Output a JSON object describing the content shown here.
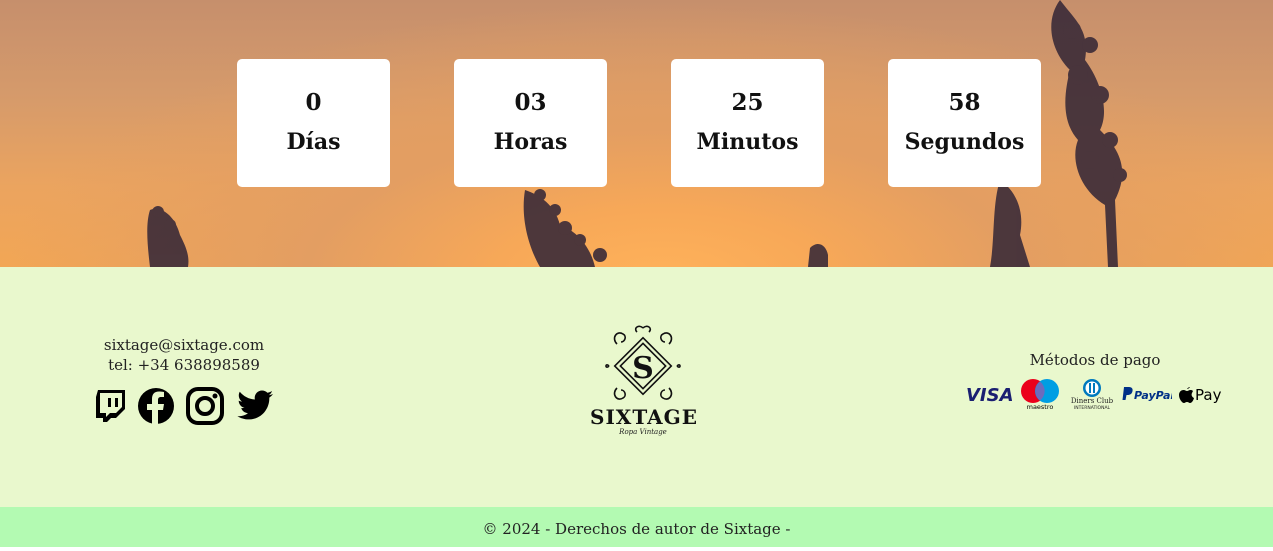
{
  "countdown": [
    {
      "value": "0",
      "label": "Días"
    },
    {
      "value": "03",
      "label": "Horas"
    },
    {
      "value": "25",
      "label": "Minutos"
    },
    {
      "value": "58",
      "label": "Segundos"
    }
  ],
  "contact": {
    "email": "sixtage@sixtage.com",
    "phone": "tel: +34 638898589"
  },
  "socials": [
    "twitch-icon",
    "facebook-icon",
    "instagram-icon",
    "twitter-icon"
  ],
  "brand": {
    "name": "SIXTAGE",
    "tagline": "Ropa Vintage"
  },
  "payments": {
    "title": "Métodos de pago",
    "methods": [
      "VISA",
      "maestro",
      "Diners Club INTERNATIONAL",
      "PayPal",
      "Pay"
    ]
  },
  "footer": {
    "copyright": "© 2024 - Derechos de autor de Sixtage -"
  },
  "colors": {
    "footer_bg": "#e9f8cd",
    "copyright_bg": "#b3fab2",
    "visa": "#1a1f71",
    "maestro_red": "#eb001b",
    "maestro_blue": "#009ee3",
    "paypal": "#003087"
  }
}
